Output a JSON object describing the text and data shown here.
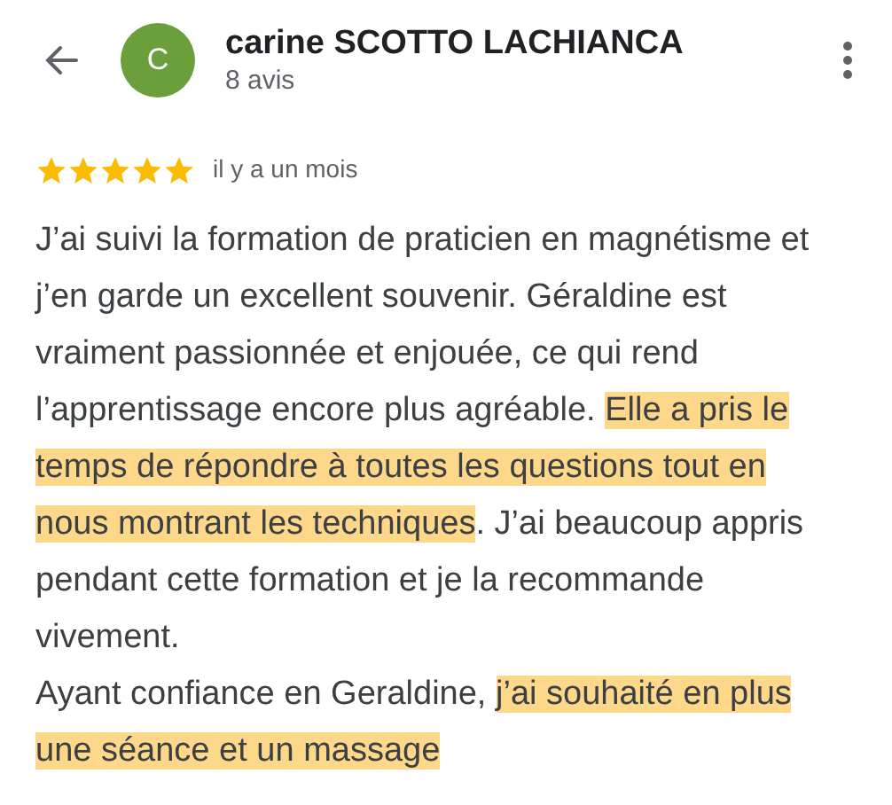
{
  "header": {
    "avatar_letter": "C",
    "name": "carine SCOTTO LACHIANCA",
    "review_count": "8 avis"
  },
  "rating": {
    "stars": 5,
    "time": "il y a un mois"
  },
  "review": {
    "paragraphs": [
      [
        {
          "text": "J’ai suivi la formation de praticien en magnétisme et j’en garde un excellent souvenir. Géraldine est vraiment passionnée et enjouée, ce qui rend l’apprentissage encore plus agréable. ",
          "highlighted": false
        },
        {
          "text": "Elle a pris le temps de répondre à toutes les questions tout en nous montrant les techniques",
          "highlighted": true
        },
        {
          "text": ". J’ai beaucoup appris pendant cette formation et je la recommande vivement.",
          "highlighted": false
        }
      ],
      [
        {
          "text": "Ayant confiance en Geraldine, ",
          "highlighted": false
        },
        {
          "text": "j’ai souhaité en plus une séance et un massage",
          "highlighted": true
        }
      ]
    ]
  }
}
